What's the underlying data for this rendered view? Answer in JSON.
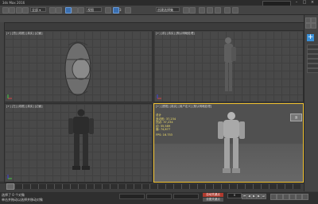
{
  "window": {
    "title": "3ds Max 2016"
  },
  "toolbar": {
    "view_dropdown": "视图",
    "snap_value": "3",
    "selection_set": "创建选择集"
  },
  "viewports": [
    {
      "label": "[+] [顶] [线框] [真实] [边面]"
    },
    {
      "label": "[+] [前] [真实] [默认明暗处理]"
    },
    {
      "label": "[+] [左] [线框] [真实] [边面]"
    },
    {
      "label": "[+] [透视] [真实] [用户定义] [默认明暗处理]"
    }
  ],
  "stats": {
    "heading": "总计",
    "rows": [
      {
        "label": "多边形:",
        "value": "37,234"
      },
      {
        "label": "顶点:",
        "value": "37,234"
      },
      {
        "label": "边:",
        "value": "55,589"
      },
      {
        "label": "面:",
        "value": "74,677"
      },
      {
        "label": "FPS:",
        "value": "16.753"
      }
    ]
  },
  "viewcube": {
    "label": "顶"
  },
  "status": {
    "line1": "选择了 0 个对象",
    "line2": "单击并拖动以选择并移动对象",
    "autokey": "自动关键点",
    "setkey": "设置关键点",
    "frame": "0"
  },
  "colors": {
    "active_viewport_border": "#f2c230",
    "stats_text": "#f6e36a",
    "accent_blue": "#3a8fd6",
    "autokey_red": "#b03a2e"
  },
  "icons": [
    "undo-icon",
    "redo-icon",
    "link-icon",
    "unlink-icon",
    "select-icon",
    "move-icon",
    "rotate-icon",
    "scale-icon",
    "snap-icon",
    "mirror-icon",
    "align-icon",
    "render-icon"
  ]
}
